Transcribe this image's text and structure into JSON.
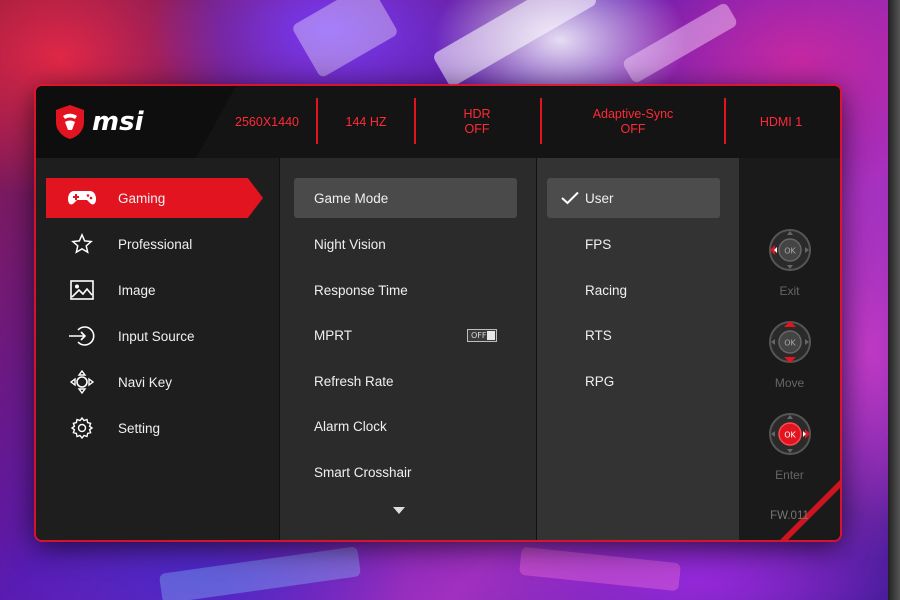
{
  "brand": {
    "name": "msi",
    "accent": "#e2141f"
  },
  "status_bar": {
    "resolution": "2560X1440",
    "refresh": "144 HZ",
    "hdr_line1": "HDR",
    "hdr_line2": "OFF",
    "adaptive_line1": "Adaptive-Sync",
    "adaptive_line2": "OFF",
    "input": "HDMI 1"
  },
  "main_menu": {
    "items": [
      {
        "label": "Gaming",
        "icon": "gamepad-icon",
        "active": true
      },
      {
        "label": "Professional",
        "icon": "star-icon"
      },
      {
        "label": "Image",
        "icon": "image-icon"
      },
      {
        "label": "Input Source",
        "icon": "input-source-icon"
      },
      {
        "label": "Navi Key",
        "icon": "navi-key-icon"
      },
      {
        "label": "Setting",
        "icon": "gear-icon"
      }
    ]
  },
  "sub_menu": {
    "items": [
      {
        "label": "Game Mode",
        "active": true
      },
      {
        "label": "Night Vision"
      },
      {
        "label": "Response Time"
      },
      {
        "label": "MPRT",
        "toggle": "OFF"
      },
      {
        "label": "Refresh Rate"
      },
      {
        "label": "Alarm Clock"
      },
      {
        "label": "Smart Crosshair"
      }
    ],
    "more_icon": "chevron-down-icon"
  },
  "options": {
    "items": [
      {
        "label": "User",
        "selected": true
      },
      {
        "label": "FPS"
      },
      {
        "label": "Racing"
      },
      {
        "label": "RTS"
      },
      {
        "label": "RPG"
      }
    ]
  },
  "controls": {
    "center_label": "OK",
    "exit": "Exit",
    "move": "Move",
    "enter": "Enter",
    "firmware": "FW.011"
  }
}
